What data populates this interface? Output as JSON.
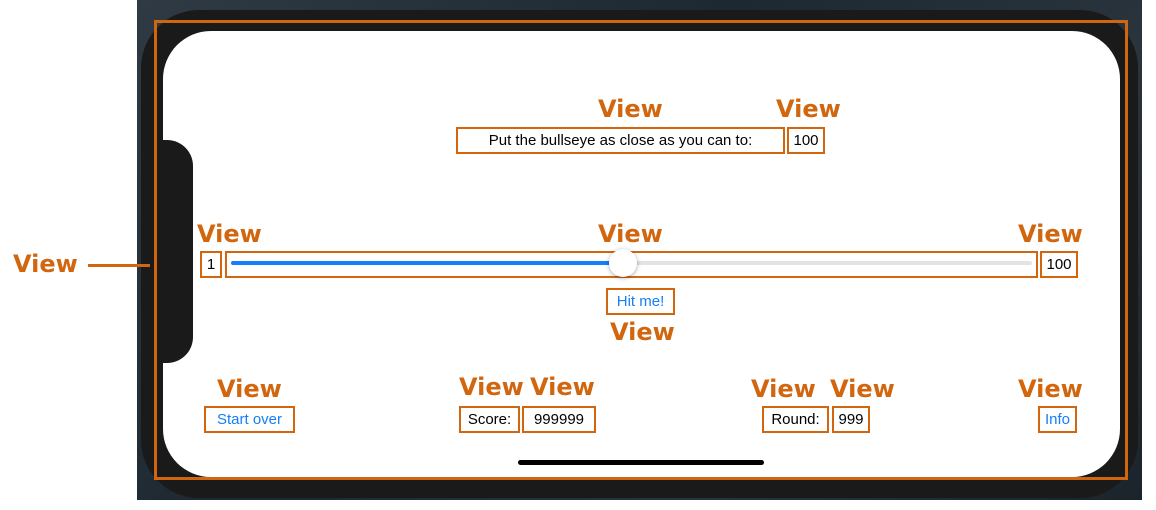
{
  "annotation_label": "View",
  "target_row": {
    "prompt": "Put the bullseye as close as you can to:",
    "target_value": "100"
  },
  "slider": {
    "min_label": "1",
    "max_label": "100",
    "value_fraction": 0.49
  },
  "hit_button": {
    "label": "Hit me!"
  },
  "bottom_bar": {
    "start_over_label": "Start over",
    "score_label": "Score:",
    "score_value": "999999",
    "round_label": "Round:",
    "round_value": "999",
    "info_label": "Info"
  },
  "colors": {
    "annotation": "#d2660f",
    "tint": "#147efb",
    "track": "#e3e3e6"
  }
}
